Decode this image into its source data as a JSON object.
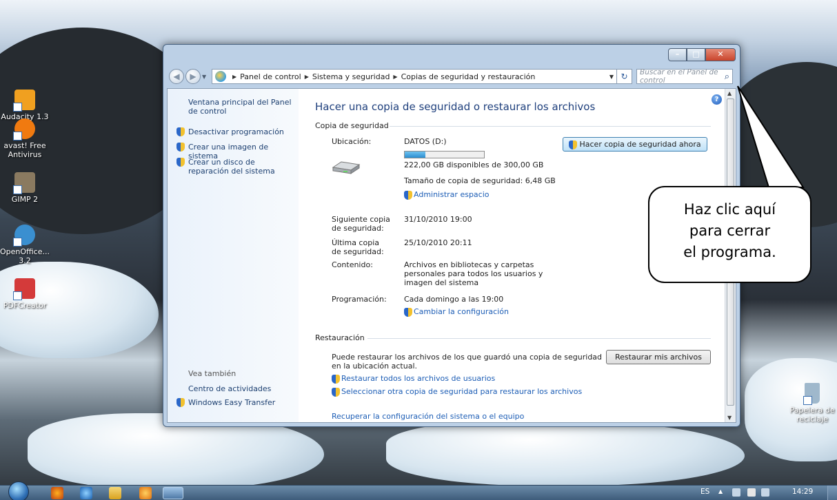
{
  "desktop": {
    "icons": [
      {
        "label": "Audacity 1.3",
        "color": "#f0a020"
      },
      {
        "label": "avast! Free Antivirus",
        "color": "#f07a10"
      },
      {
        "label": "GIMP 2",
        "color": "#8a7a60"
      },
      {
        "label": "OpenOffice... 3.2",
        "color": "#3a8fd0"
      },
      {
        "label": "PDFCreator",
        "color": "#d43a3a"
      },
      {
        "label": "Papelera de reciclaje",
        "color": "#9fb8cc"
      }
    ]
  },
  "window": {
    "controls": {
      "minimize": "–",
      "maximize": "□",
      "close": "✕"
    },
    "address": {
      "breadcrumbs": [
        "Panel de control",
        "Sistema y seguridad",
        "Copias de seguridad y restauración"
      ],
      "search_placeholder": "Buscar en el Panel de control"
    },
    "left_pane": {
      "home_link": "Ventana principal del Panel de control",
      "tasks": [
        "Desactivar programación",
        "Crear una imagen de sistema",
        "Crear un disco de reparación del sistema"
      ],
      "see_also_heading": "Vea también",
      "see_also": [
        "Centro de actividades",
        "Windows Easy Transfer"
      ]
    },
    "main": {
      "title": "Hacer una copia de seguridad o restaurar los archivos",
      "backup_section": "Copia de seguridad",
      "location_label": "Ubicación:",
      "location_value": "DATOS (D:)",
      "disk_usage_fraction": 0.26,
      "free_space": "222,00 GB disponibles de 300,00 GB",
      "backup_size": "Tamaño de copia de seguridad: 6,48 GB",
      "manage_space_link": "Administrar espacio",
      "backup_now_button": "Hacer copia de seguridad ahora",
      "next_backup_label": "Siguiente copia de seguridad:",
      "next_backup_value": "31/10/2010 19:00",
      "last_backup_label": "Última copia de seguridad:",
      "last_backup_value": "25/10/2010 20:11",
      "contents_label": "Contenido:",
      "contents_value": "Archivos en bibliotecas y carpetas personales para todos los usuarios y imagen del sistema",
      "schedule_label": "Programación:",
      "schedule_value": "Cada domingo a las 19:00",
      "change_settings_link": "Cambiar la configuración",
      "restore_section": "Restauración",
      "restore_text": "Puede restaurar los archivos de los que guardó una copia de seguridad en la ubicación actual.",
      "restore_button": "Restaurar mis archivos",
      "restore_all_link": "Restaurar todos los archivos de usuarios",
      "select_other_link": "Seleccionar otra copia de seguridad para restaurar los archivos",
      "recover_link": "Recuperar la configuración del sistema o el equipo"
    }
  },
  "callout": {
    "lines": [
      "Haz clic aquí",
      "para cerrar",
      "el programa."
    ]
  },
  "taskbar": {
    "language": "ES",
    "time": "14:29"
  }
}
